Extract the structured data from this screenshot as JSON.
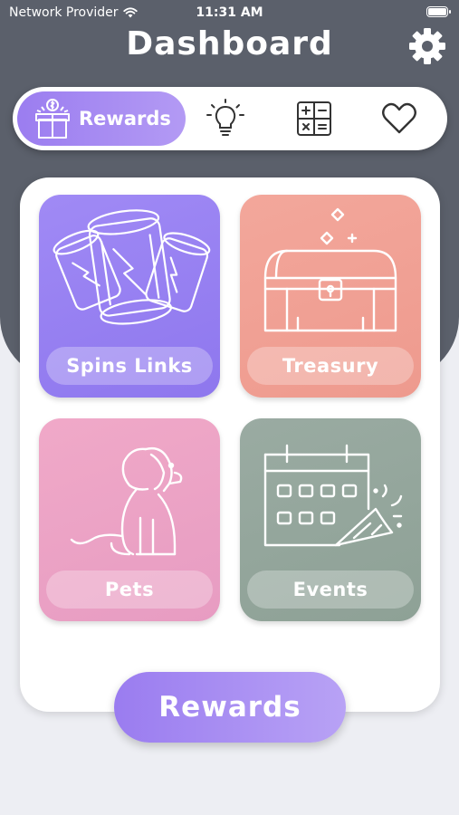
{
  "status_bar": {
    "carrier": "Network Provider",
    "time": "11:31 AM"
  },
  "header": {
    "title": "Dashboard",
    "settings_icon": "gear-icon"
  },
  "tabs": [
    {
      "label": "Rewards",
      "icon": "gift-icon",
      "active": true
    },
    {
      "label": "",
      "icon": "lightbulb-icon",
      "active": false
    },
    {
      "label": "",
      "icon": "calculator-icon",
      "active": false
    },
    {
      "label": "",
      "icon": "heart-icon",
      "active": false
    }
  ],
  "tiles": [
    {
      "label": "Spins Links",
      "icon": "spin-cans-icon",
      "color": "#9a83f3"
    },
    {
      "label": "Treasury",
      "icon": "treasure-chest-icon",
      "color": "#f1a196"
    },
    {
      "label": "Pets",
      "icon": "dog-icon",
      "color": "#eca4c6"
    },
    {
      "label": "Events",
      "icon": "calendar-party-icon",
      "color": "#96a79d"
    }
  ],
  "cta": {
    "label": "Rewards"
  },
  "colors": {
    "header": "#5b606b",
    "accent": "#9b7df0",
    "background": "#edeef3"
  }
}
